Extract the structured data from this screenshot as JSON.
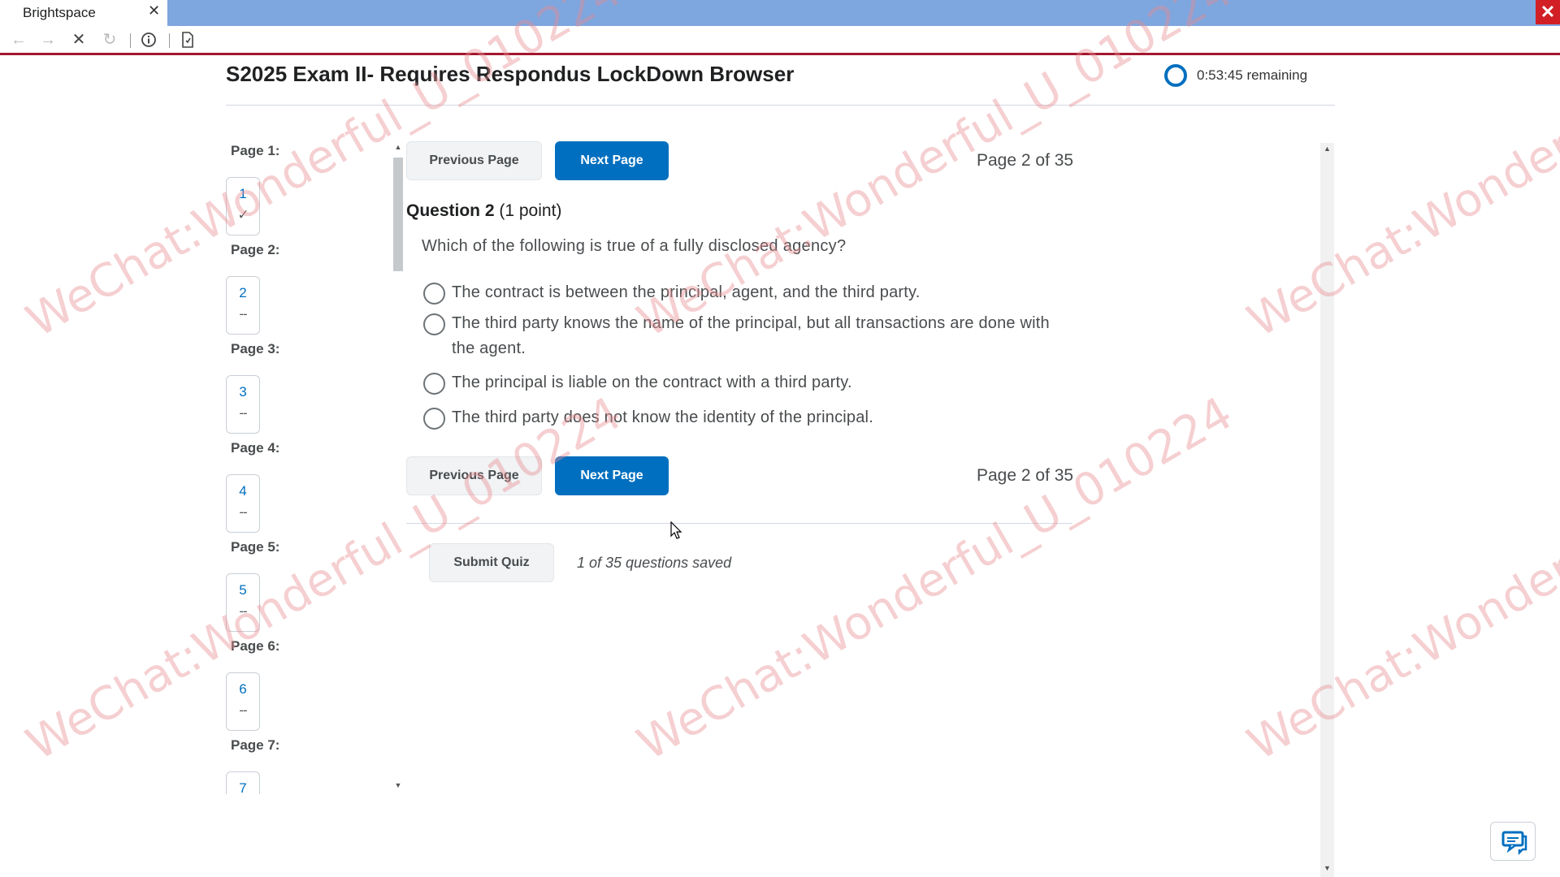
{
  "browser": {
    "tab_title": "Brightspace",
    "tab_close": "✕",
    "window_close": "✕",
    "toolbar_icons": [
      "back-arrow-icon",
      "forward-arrow-icon",
      "stop-icon",
      "reload-icon",
      "info-icon",
      "page-icon"
    ]
  },
  "header": {
    "exam_title": "S2025 Exam II- Requires Respondus LockDown Browser",
    "timer_text": "0:53:45 remaining"
  },
  "nav": {
    "pages": [
      {
        "label": "Page 1:",
        "number": "1",
        "status": "✓"
      },
      {
        "label": "Page 2:",
        "number": "2",
        "status": "--"
      },
      {
        "label": "Page 3:",
        "number": "3",
        "status": "--"
      },
      {
        "label": "Page 4:",
        "number": "4",
        "status": "--"
      },
      {
        "label": "Page 5:",
        "number": "5",
        "status": "--"
      },
      {
        "label": "Page 6:",
        "number": "6",
        "status": "--"
      },
      {
        "label": "Page 7:",
        "number": "7",
        "status": ""
      }
    ]
  },
  "pager": {
    "prev_label": "Previous Page",
    "next_label": "Next Page",
    "page_indicator": "Page 2 of 35"
  },
  "question": {
    "title": "Question 2",
    "points": "(1 point)",
    "text": "Which of the following is true of a fully disclosed agency?",
    "options": [
      "The contract is between the principal, agent, and the third party.",
      "The third party knows the name of the principal, but all transactions are done with the agent.",
      "The principal is liable on the contract with a third party.",
      "The third party does not know the identity of the principal."
    ]
  },
  "footer": {
    "submit_label": "Submit Quiz",
    "saved_text": "1 of 35 questions saved"
  },
  "watermark_text": "WeChat:Wonderful_U_010224",
  "colors": {
    "accent": "#006fbf",
    "tabbar": "#7ea6df",
    "top_border": "#a3172e",
    "window_close": "#d21f26",
    "watermark": "#e78c91"
  }
}
